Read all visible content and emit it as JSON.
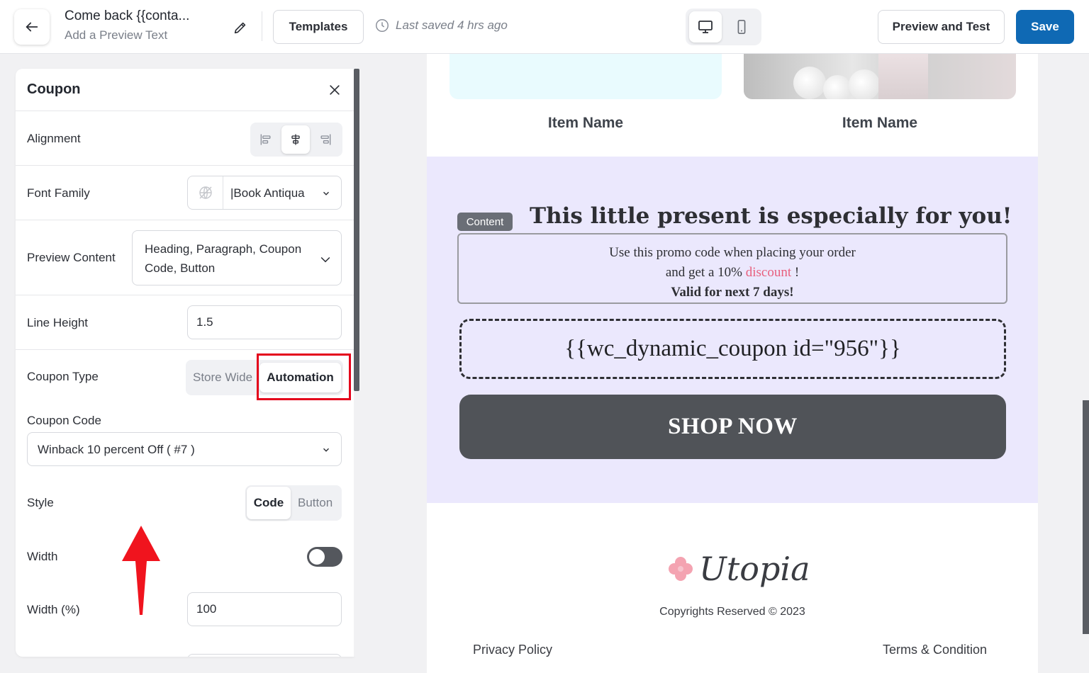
{
  "header": {
    "title": "Come back {{conta...",
    "preview_text": "Add a Preview Text",
    "templates_label": "Templates",
    "last_saved": "Last saved 4 hrs ago",
    "preview_test_label": "Preview and Test",
    "save_label": "Save"
  },
  "panel": {
    "title": "Coupon",
    "alignment_label": "Alignment",
    "font_family_label": "Font Family",
    "font_family_value": "Book Antiqua",
    "preview_content_label": "Preview Content",
    "preview_content_value": "Heading, Paragraph, Coupon Code, Button",
    "line_height_label": "Line Height",
    "line_height_value": "1.5",
    "coupon_type_label": "Coupon Type",
    "coupon_type_options": [
      "Store Wide",
      "Automation"
    ],
    "coupon_type_selected": "Automation",
    "coupon_code_label": "Coupon Code",
    "coupon_code_value": "Winback 10 percent Off ( #7 )",
    "style_label": "Style",
    "style_options": [
      "Code",
      "Button"
    ],
    "style_selected": "Code",
    "width_label": "Width",
    "width_toggle": false,
    "width_pct_label": "Width (%)",
    "width_pct_value": "100"
  },
  "email": {
    "items": [
      {
        "name": "Item Name"
      },
      {
        "name": "Item Name"
      }
    ],
    "content_tag": "Content",
    "heading": "This little present is especially for you!",
    "paragraph_line1": "Use this promo code when placing your order",
    "paragraph_line2_pre": "and get a 10% ",
    "paragraph_line2_link": "discount",
    "paragraph_line2_post": " !",
    "paragraph_line3": "Valid for next 7 days!",
    "coupon_code": "{{wc_dynamic_coupon id=\"956\"}}",
    "button_label": "SHOP NOW",
    "brand": "Utopia",
    "copyright": "Copyrights Reserved © 2023",
    "footer_left": "Privacy Policy",
    "footer_right": "Terms & Condition"
  },
  "colors": {
    "primary": "#0f69b4",
    "highlight": "#e4001b",
    "promo_bg": "#ebe8fd",
    "discount_link": "#e85f7d",
    "button_bg": "#505358"
  }
}
